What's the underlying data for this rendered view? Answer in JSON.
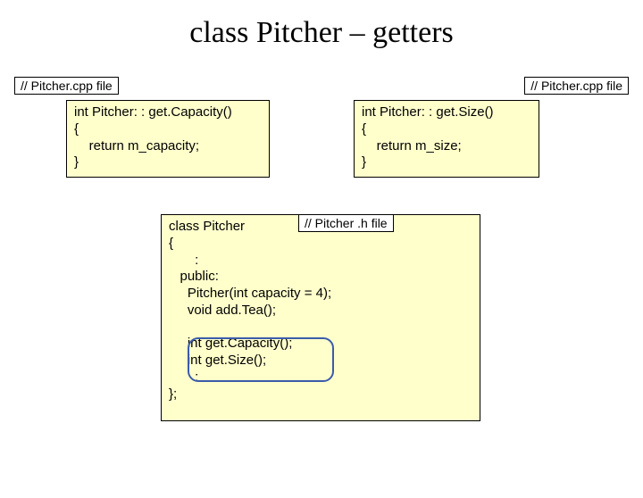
{
  "title": "class Pitcher – getters",
  "labels": {
    "cpp_file": "// Pitcher.cpp file",
    "h_file": "// Pitcher .h file"
  },
  "code": {
    "getCapacity": "int Pitcher: : get.Capacity()\n{\n    return m_capacity;\n}",
    "getSize": "int Pitcher: : get.Size()\n{\n    return m_size;\n}",
    "classDecl": "class Pitcher\n{\n       :\n   public:\n     Pitcher(int capacity = 4);\n     void add.Tea();\n\n     int get.Capacity();\n     int get.Size();\n       :\n};"
  }
}
